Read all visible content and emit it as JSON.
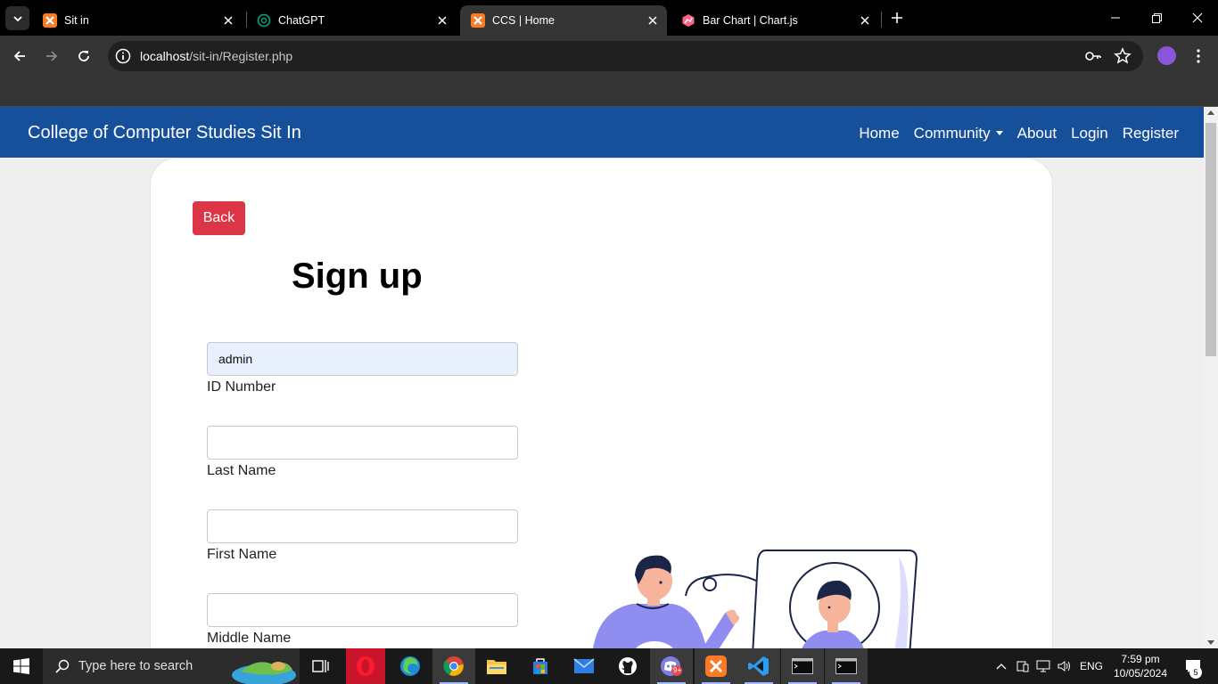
{
  "browser": {
    "tabs": [
      {
        "title": "Sit in",
        "icon": "xampp-icon",
        "active": false
      },
      {
        "title": "ChatGPT",
        "icon": "chatgpt-icon",
        "active": false
      },
      {
        "title": "CCS | Home",
        "icon": "xampp-icon",
        "active": true
      },
      {
        "title": "Bar Chart | Chart.js",
        "icon": "chartjs-icon",
        "active": false
      }
    ],
    "url_host": "localhost",
    "url_path": "/sit-in/Register.php"
  },
  "site": {
    "brand": "College of Computer Studies Sit In",
    "nav": {
      "home": "Home",
      "community": "Community",
      "about": "About",
      "login": "Login",
      "register": "Register"
    }
  },
  "form": {
    "back_label": "Back",
    "heading": "Sign up",
    "fields": [
      {
        "label": "ID Number",
        "value": "admin"
      },
      {
        "label": "Last Name",
        "value": ""
      },
      {
        "label": "First Name",
        "value": ""
      },
      {
        "label": "Middle Name",
        "value": ""
      }
    ]
  },
  "taskbar": {
    "search_placeholder": "Type here to search",
    "language": "ENG",
    "time": "7:59 pm",
    "date": "10/05/2024",
    "notification_count": "5",
    "discord_badge": "9+"
  },
  "colors": {
    "navbar": "#16509a",
    "back_button": "#dc3545",
    "autofill": "#e8f0fe"
  }
}
